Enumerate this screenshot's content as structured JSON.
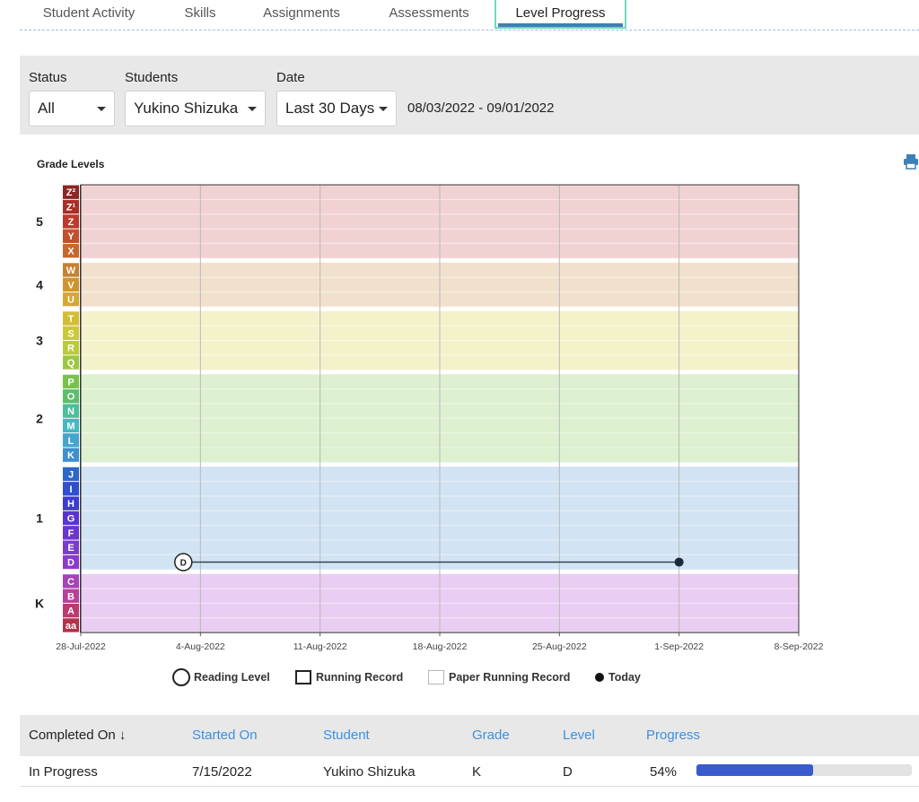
{
  "tabs": [
    {
      "label": "Student Activity"
    },
    {
      "label": "Skills"
    },
    {
      "label": "Assignments"
    },
    {
      "label": "Assessments"
    },
    {
      "label": "Level Progress"
    }
  ],
  "filters": {
    "status": {
      "label": "Status",
      "value": "All"
    },
    "students": {
      "label": "Students",
      "value": "Yukino Shizuka"
    },
    "date": {
      "label": "Date",
      "value": "Last 30 Days"
    },
    "range_text": "08/03/2022 - 09/01/2022"
  },
  "chart_title": "Grade Levels",
  "icons": {
    "print": "print-icon"
  },
  "chart_data": {
    "type": "line",
    "title": "Grade Levels",
    "x_ticks": [
      "28-Jul-2022",
      "4-Aug-2022",
      "11-Aug-2022",
      "18-Aug-2022",
      "25-Aug-2022",
      "1-Sep-2022",
      "8-Sep-2022"
    ],
    "x_range": [
      "2022-07-28",
      "2022-09-08"
    ],
    "levels": [
      "aa",
      "A",
      "B",
      "C",
      "D",
      "E",
      "F",
      "G",
      "H",
      "I",
      "J",
      "K",
      "L",
      "M",
      "N",
      "O",
      "P",
      "Q",
      "R",
      "S",
      "T",
      "U",
      "V",
      "W",
      "X",
      "Y",
      "Z",
      "Z¹",
      "Z²"
    ],
    "grade_bands": [
      {
        "grade": "K",
        "levels": [
          "aa",
          "A",
          "B",
          "C"
        ],
        "color": "#e9cdf2"
      },
      {
        "grade": "1",
        "levels": [
          "D",
          "E",
          "F",
          "G",
          "H",
          "I",
          "J"
        ],
        "color": "#d2e3f3"
      },
      {
        "grade": "2",
        "levels": [
          "K",
          "L",
          "M",
          "N",
          "O",
          "P"
        ],
        "color": "#ddf0cf"
      },
      {
        "grade": "3",
        "levels": [
          "Q",
          "R",
          "S",
          "T"
        ],
        "color": "#f4f2cb"
      },
      {
        "grade": "4",
        "levels": [
          "U",
          "V",
          "W"
        ],
        "color": "#f1e1cc"
      },
      {
        "grade": "5",
        "levels": [
          "X",
          "Y",
          "Z",
          "Z¹",
          "Z²"
        ],
        "color": "#f1d2d2"
      }
    ],
    "level_colors": {
      "aa": "#b4324a",
      "A": "#b83a6e",
      "B": "#b8409a",
      "C": "#a742b8",
      "D": "#8a3cc4",
      "E": "#7a3ccc",
      "F": "#6a36cf",
      "G": "#5a34cf",
      "H": "#3c3ccf",
      "I": "#2f4fd0",
      "J": "#2c66c8",
      "K": "#3c8fd0",
      "L": "#44a6cf",
      "M": "#44b8c0",
      "N": "#4cbf9a",
      "O": "#5cbf6c",
      "P": "#78c24a",
      "Q": "#9cc83e",
      "R": "#b9cb3a",
      "S": "#cbc838",
      "T": "#d3bd36",
      "U": "#d3a834",
      "V": "#cf9430",
      "W": "#c98030",
      "X": "#c7672e",
      "Y": "#c44f2c",
      "Z": "#bd3a2a",
      "Z¹": "#a82e28",
      "Z²": "#8e2424"
    },
    "series": [
      {
        "type": "reading-level",
        "points": [
          {
            "x": "2022-08-03",
            "y": "D",
            "label": "D"
          },
          {
            "x": "2022-09-01",
            "y": "D"
          }
        ]
      }
    ],
    "today": {
      "x": "2022-09-01",
      "y": "D"
    },
    "legend": [
      "Reading Level",
      "Running Record",
      "Paper Running Record",
      "Today"
    ]
  },
  "table": {
    "headers": {
      "completed": "Completed On ↓",
      "started": "Started On",
      "student": "Student",
      "grade": "Grade",
      "level": "Level",
      "progress": "Progress"
    },
    "rows": [
      {
        "completed": "In Progress",
        "started": "7/15/2022",
        "student": "Yukino Shizuka",
        "grade": "K",
        "level": "D",
        "progress_text": "54%",
        "progress": 0.54
      }
    ]
  },
  "colors": {
    "accent": "#3d8fe0",
    "tab_highlight": "#6fd8c0",
    "progress_fill": "#3a5bcd"
  }
}
